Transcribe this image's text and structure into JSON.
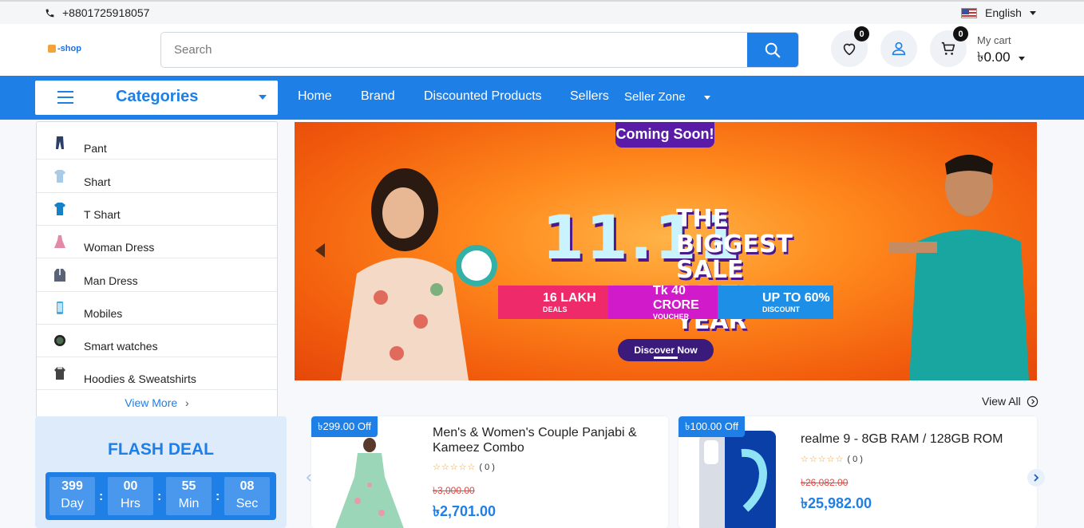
{
  "topbar": {
    "phone": "+8801725918057",
    "language": "English"
  },
  "header": {
    "logo_text": "-shop",
    "search_placeholder": "Search",
    "wishlist_count": "0",
    "cart_count": "0",
    "cart_label": "My cart",
    "cart_amount": "৳0.00"
  },
  "nav": {
    "categories_label": "Categories",
    "links": [
      "Home",
      "Brand",
      "Discounted Products",
      "Sellers",
      "Seller Zone"
    ]
  },
  "categories": {
    "items": [
      {
        "label": "Pant",
        "icon": "pant-icon"
      },
      {
        "label": "Shart",
        "icon": "shirt-icon"
      },
      {
        "label": "T Shart",
        "icon": "tshirt-icon"
      },
      {
        "label": "Woman Dress",
        "icon": "dress-icon"
      },
      {
        "label": "Man Dress",
        "icon": "suit-icon"
      },
      {
        "label": "Mobiles",
        "icon": "mobile-icon"
      },
      {
        "label": "Smart watches",
        "icon": "watch-icon"
      },
      {
        "label": "Hoodies & Sweatshirts",
        "icon": "hoodie-icon"
      }
    ],
    "view_more": "View More"
  },
  "banner": {
    "coming_soon": "Coming Soon!",
    "headline": "11.11",
    "sale_text": "THE BIGGEST SALE OF THE YEAR",
    "pills": [
      {
        "main": "16 LAKH",
        "sub": "DEALS"
      },
      {
        "main": "Tk 40 CRORE",
        "sub": "VOUCHER"
      },
      {
        "main": "UP TO 60%",
        "sub": "DISCOUNT"
      }
    ],
    "cta": "Discover Now"
  },
  "flash_deal": {
    "title": "FLASH DEAL",
    "timer": [
      {
        "value": "399",
        "unit": "Day"
      },
      {
        "value": "00",
        "unit": "Hrs"
      },
      {
        "value": "55",
        "unit": "Min"
      },
      {
        "value": "08",
        "unit": "Sec"
      }
    ]
  },
  "products_section": {
    "view_all": "View All"
  },
  "products": [
    {
      "discount": "৳299.00 Off",
      "name": "Men's & Women's Couple Panjabi & Kameez Combo",
      "rating": "( 0 )",
      "old_price": "৳3,000.00",
      "price": "৳2,701.00"
    },
    {
      "discount": "৳100.00 Off",
      "name": "realme 9 - 8GB RAM / 128GB ROM",
      "rating": "( 0 )",
      "old_price": "৳26,082.00",
      "price": "৳25,982.00"
    }
  ],
  "colors": {
    "primary": "#1e7fe6",
    "banner": "#f25d0d",
    "sale_red": "#e8453c"
  }
}
